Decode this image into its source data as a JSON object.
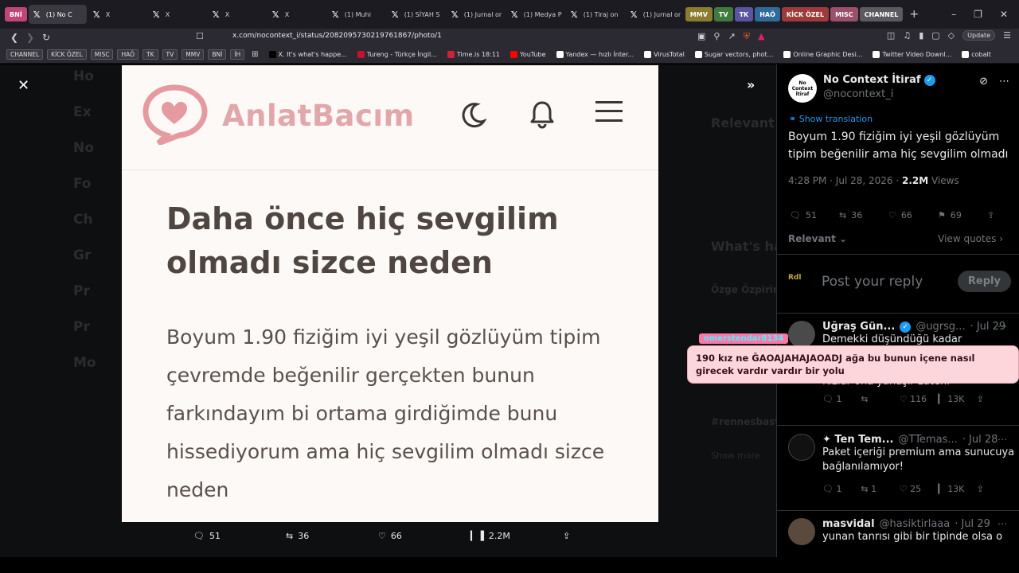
{
  "browser": {
    "tabs": [
      {
        "label": "BNİ",
        "type": "pill",
        "color": "#c2457a"
      },
      {
        "label": "(1) No C",
        "type": "tab",
        "active": true
      },
      {
        "label": "X",
        "type": "tab"
      },
      {
        "label": "X",
        "type": "tab"
      },
      {
        "label": "X",
        "type": "tab"
      },
      {
        "label": "X",
        "type": "tab"
      },
      {
        "label": "(1) Muhi",
        "type": "tab"
      },
      {
        "label": "(1) SİYAH S",
        "type": "tab"
      },
      {
        "label": "(1) Jurnal or",
        "type": "tab"
      },
      {
        "label": "(1) Medya P",
        "type": "tab"
      },
      {
        "label": "(1) Tiraj on",
        "type": "tab"
      },
      {
        "label": "(1) Jurnal or",
        "type": "tab"
      }
    ],
    "tab_groups": [
      {
        "label": "MMV",
        "color": "#8a7d2f"
      },
      {
        "label": "TV",
        "color": "#3f7a3f"
      },
      {
        "label": "TK",
        "color": "#5a55a0"
      },
      {
        "label": "HAÖ",
        "color": "#2f6b9a"
      },
      {
        "label": "KİCK ÖZEL",
        "color": "#a03a3a"
      },
      {
        "label": "MISC",
        "color": "#9a4f6b"
      },
      {
        "label": "CHANNEL",
        "color": "#5a5a60"
      }
    ],
    "new_tab_label": "+",
    "url": "x.com/nocontext_i/status/2082095730219761867/photo/1",
    "update_label": "Update",
    "bookmark_pills": [
      "CHANNEL",
      "KİCK ÖZEL",
      "MISC",
      "HAÖ",
      "TK",
      "TV",
      "MMV",
      "BNİ",
      "İH"
    ],
    "bookmarks": [
      {
        "label": "X. It's what's happe...",
        "color": "#000000"
      },
      {
        "label": "Tureng - Türkçe İngil...",
        "color": "#c8102e"
      },
      {
        "label": "Time.is 18:11",
        "color": "#d0213b"
      },
      {
        "label": "YouTube",
        "color": "#ff0000"
      },
      {
        "label": "Yandex — hızlı İnter...",
        "color": "#ffffff"
      },
      {
        "label": "VirusTotal",
        "color": "#ffffff"
      },
      {
        "label": "Sugar vectors, phot...",
        "color": "#ffffff"
      },
      {
        "label": "Online Graphic Desi...",
        "color": "#ffffff"
      },
      {
        "label": "Twitter Video Downl...",
        "color": "#ffffff"
      },
      {
        "label": "cobalt",
        "color": "#ffffff"
      }
    ]
  },
  "photo": {
    "brand": "AnlatBacım",
    "title": "Daha önce hiç sevgilim olmadı sizce neden",
    "body": "Boyum 1.90 fiziğim iyi yeşil gözlüyüm tipim çevremde beğenilir gerçekten bunun farkındayım bi ortama girdiğimde bunu hissediyorum ama hiç sevgilim olmadı sizce neden"
  },
  "photo_actions": {
    "replies": "51",
    "reposts": "36",
    "likes": "66",
    "views": "2.2M"
  },
  "tweet": {
    "author_name": "No Context İtiraf",
    "avatar_text": "No Context İtiraf",
    "handle": "@nocontext_i",
    "translate_label": "Show translation",
    "text": "Boyum 1.90 fiziğim iyi yeşil gözlüyüm tipim beğenilir ama hiç sevgilim olmadı",
    "time": "4:28 PM · Jul 28, 2026 · ",
    "views_count": "2.2M",
    "views_label": " Views",
    "stats": {
      "replies": "51",
      "reposts": "36",
      "likes": "66",
      "bookmarks": "69"
    },
    "sort_label": "Relevant",
    "view_quotes_label": "View quotes",
    "reply_placeholder": "Post your reply",
    "reply_button": "Reply",
    "reply_avatar_text": "Rdl"
  },
  "replies": [
    {
      "name": "Uğraş Gün...",
      "handle": "@ugrsg...",
      "date": "· Jul 29",
      "text_top": "Demekki düşündüğü kadar",
      "text_bottom": "Kızlar ona yanaşır zaten.",
      "replies": "1",
      "reposts": "",
      "likes": "116",
      "views": "13K"
    },
    {
      "name": "✦ Ten Tem...",
      "handle": "@TTemas...",
      "date": "· Jul 28",
      "text": "Paket içeriği premium ama sunucuya bağlanılamıyor!",
      "replies": "1",
      "reposts": "1",
      "likes": "25",
      "views": "13K"
    },
    {
      "name": "masvidal",
      "handle": "@hasiktirlaaa",
      "date": "· Jul 29",
      "text": "yunan tanrısı gibi bir tipinde olsa o"
    }
  ],
  "chat_overlay": {
    "username": "omerstendar8134",
    "message": "190 kız ne ĞAOAJAHAJAOADJ ağa bu bunun içene nasıl girecek vardır vardır bir yolu"
  },
  "ghost_nav": [
    "Ho",
    "Ex",
    "No",
    "Fo",
    "Ch",
    "Gr",
    "Pr",
    "Pr",
    "Mo"
  ],
  "ghost_right": {
    "relevant": "Relevant",
    "whats": "What's ha",
    "person": "Özge Özpirin",
    "hashtag": "#rennesbast",
    "show": "Show more"
  }
}
